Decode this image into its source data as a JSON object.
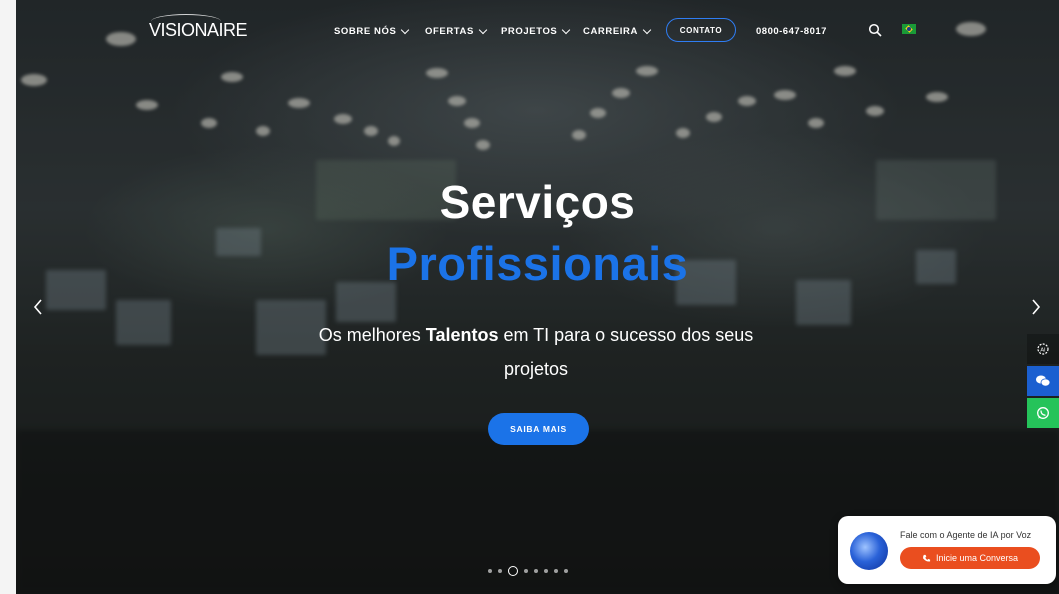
{
  "header": {
    "logo_text": "VISIONAIRE",
    "nav": [
      {
        "label": "SOBRE NÓS"
      },
      {
        "label": "OFERTAS"
      },
      {
        "label": "PROJETOS"
      },
      {
        "label": "CARREIRA"
      }
    ],
    "contact_label": "CONTATO",
    "phone": "0800-647-8017",
    "search_icon": "search-icon",
    "flag_icon": "brazil-flag-icon"
  },
  "hero": {
    "title_line1": "Serviços",
    "title_line2": "Profissionais",
    "subtitle_pre": "Os melhores ",
    "subtitle_bold": "Talentos",
    "subtitle_post": " em TI para o sucesso dos seus projetos",
    "cta_label": "SAIBA MAIS",
    "slides_total": 8,
    "active_slide": 3,
    "colors": {
      "accent": "#1b73e8",
      "whatsapp": "#25c35a",
      "voice_cta": "#ea4e1f"
    }
  },
  "side_buttons": [
    "ai-icon",
    "chat-icon",
    "whatsapp-icon"
  ],
  "voice_widget": {
    "text": "Fale com o Agente de IA por Voz",
    "button_label": "Inicie uma Conversa"
  }
}
